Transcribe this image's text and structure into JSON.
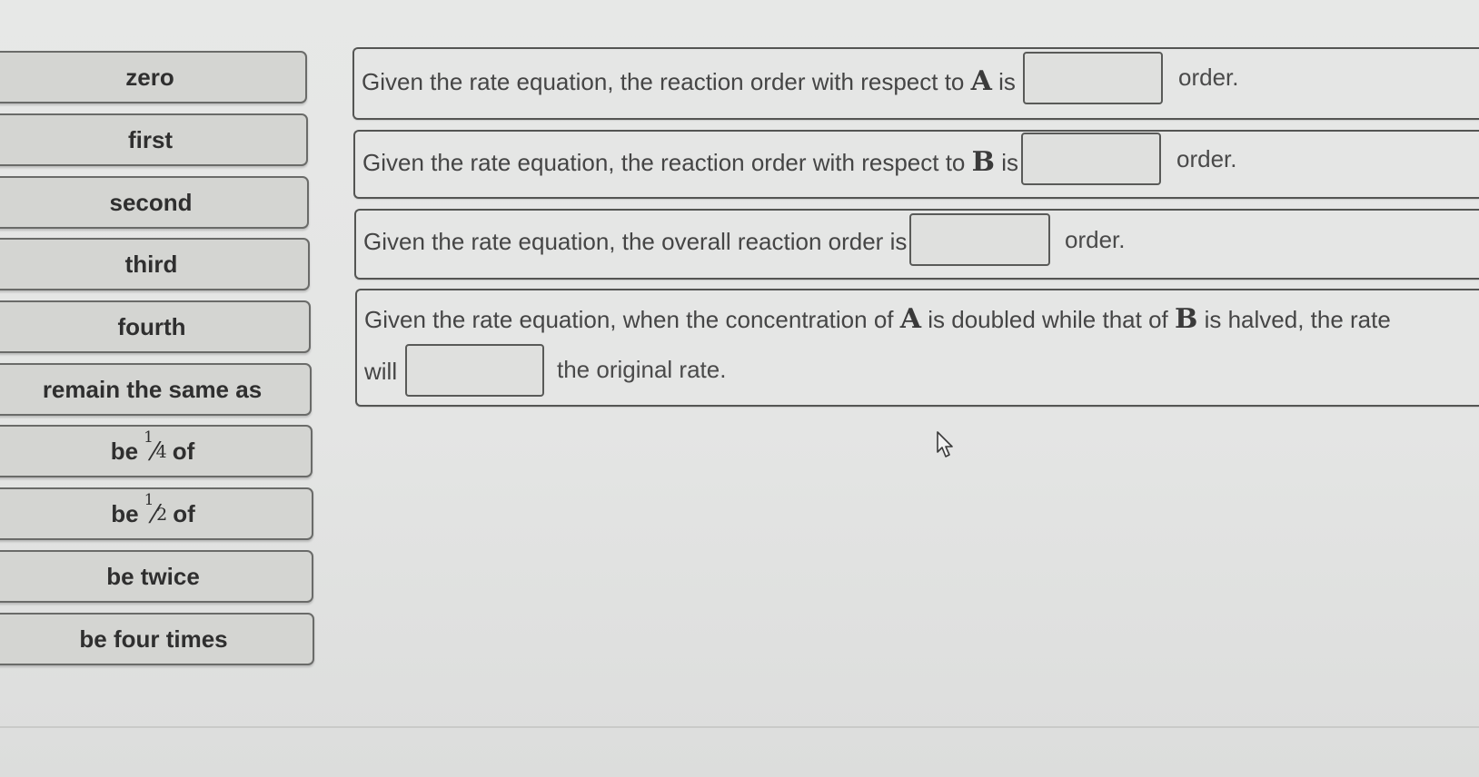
{
  "answer_bank": {
    "zero": "zero",
    "first": "first",
    "second": "second",
    "third": "third",
    "fourth": "fourth",
    "remain_same": "remain the same as",
    "be_quarter": {
      "pre": "be",
      "num": "1",
      "den": "4",
      "post": "of"
    },
    "be_half": {
      "pre": "be",
      "num": "1",
      "den": "2",
      "post": "of"
    },
    "be_twice": "be twice",
    "be_four_times": "be four times"
  },
  "questions": {
    "q1": {
      "prefix": "Given the rate equation, the reaction order with respect to",
      "var": "A",
      "is": "is",
      "suffix": "order."
    },
    "q2": {
      "prefix": "Given the rate equation, the reaction order with respect to",
      "var": "B",
      "is": "is",
      "suffix": "order."
    },
    "q3": {
      "prefix": "Given the rate equation, the overall reaction order is",
      "suffix": "order."
    },
    "q4": {
      "part1": "Given the rate equation, when the concentration of",
      "var1": "A",
      "part2": "is doubled while that of",
      "var2": "B",
      "part3": "is halved, the rate",
      "will": "will",
      "suffix": "the original rate."
    }
  },
  "colors": {
    "tile_bg": "#d4d5d2",
    "border": "#595a58",
    "background": "#e5e6e5"
  },
  "icons": {
    "pointer": "mouse-pointer-icon"
  }
}
